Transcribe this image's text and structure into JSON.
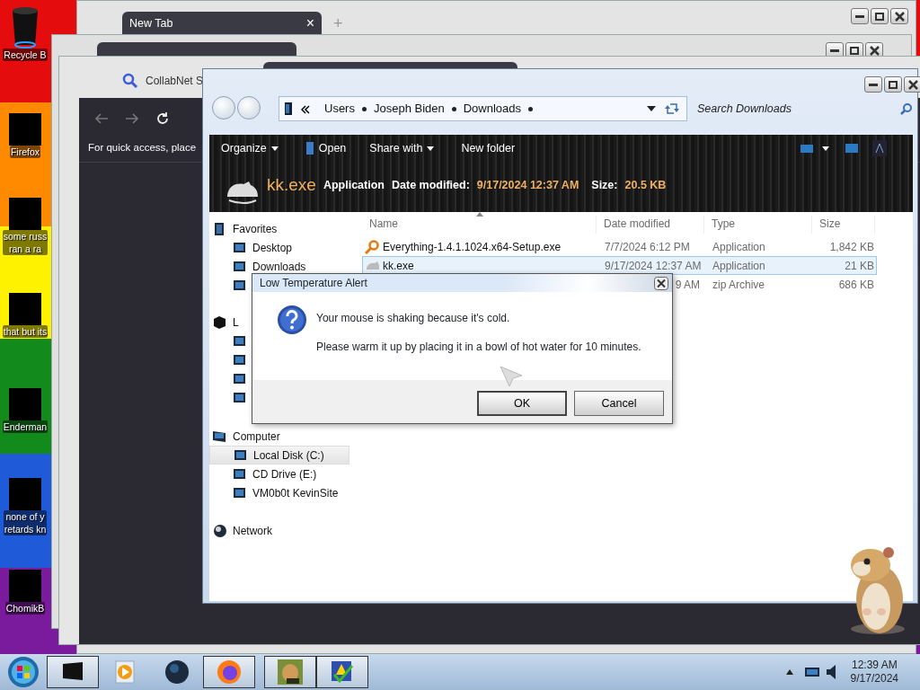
{
  "desktop_icons": [
    {
      "lines": [
        "Recycle B"
      ],
      "kind": "bin"
    },
    {
      "lines": [
        "Firefox"
      ],
      "kind": "app"
    },
    {
      "lines": [
        "some russ",
        "ran a ra"
      ],
      "kind": "app"
    },
    {
      "lines": [
        "that but its"
      ],
      "kind": "app"
    },
    {
      "lines": [
        "Enderman"
      ],
      "kind": "app"
    },
    {
      "lines": [
        "none of y",
        "retards kn"
      ],
      "kind": "app"
    },
    {
      "lines": [
        "ChomikB"
      ],
      "kind": "app"
    }
  ],
  "browser_back": {
    "tab": "New Tab",
    "close": "×",
    "new_tab": "+"
  },
  "browser_front": {
    "tab": "CollabNet S",
    "bookmarks_hint": "For quick access, place"
  },
  "explorer": {
    "breadcrumb": [
      "Users",
      "Joseph Biden",
      "Downloads"
    ],
    "search": {
      "placeholder": "Search Downloads"
    },
    "toolbar": [
      {
        "label": "Organize",
        "dropdown": true
      },
      {
        "label": "Open",
        "dropdown": false
      },
      {
        "label": "Share with",
        "dropdown": true
      },
      {
        "label": "New folder",
        "dropdown": false
      }
    ],
    "details": {
      "name": "kk.exe",
      "type": "Application",
      "date_label": "Date modified:",
      "date": "9/17/2024 12:37 AM",
      "size_label": "Size:",
      "size": "20.5 KB"
    },
    "columns": [
      "Name",
      "Date modified",
      "Type",
      "Size"
    ],
    "files": [
      {
        "name": "Everything-1.4.1.1024.x64-Setup.exe",
        "date": "7/7/2024 6:12 PM",
        "type": "Application",
        "size": "1,842 KB",
        "partial": false,
        "selected": false
      },
      {
        "name": "kk.exe",
        "date": "9/17/2024 12:37 AM",
        "type": "Application",
        "size": "21 KB",
        "partial": false,
        "selected": true
      },
      {
        "date": "9 AM",
        "partial": true,
        "type": "zip Archive",
        "size": "686 KB",
        "selected": false
      }
    ],
    "nav": [
      {
        "label": "Favorites",
        "selected": false,
        "children": [
          {
            "label": "Desktop",
            "selected": false
          },
          {
            "label": "Downloads",
            "selected": false
          },
          {
            "selected": false
          }
        ]
      },
      {
        "label": "L",
        "selected": false,
        "children": [
          {
            "selected": false
          },
          {
            "selected": false
          },
          {
            "selected": false
          },
          {
            "selected": false
          }
        ]
      },
      {
        "label": "Computer",
        "selected": false,
        "children": [
          {
            "label": "Local Disk (C:)",
            "selected": true
          },
          {
            "label": "CD Drive (E:)",
            "selected": false
          },
          {
            "label": "VM0b0t KevinSite",
            "selected": false
          }
        ]
      },
      {
        "label": "Network",
        "selected": false
      }
    ]
  },
  "dialog": {
    "title": "Low Temperature Alert",
    "lines": [
      "Your mouse is shaking because it's cold.",
      "Please warm it up by placing it in a bowl of hot water for 10 minutes."
    ],
    "buttons": [
      {
        "label": "OK",
        "default": true
      },
      {
        "label": "Cancel",
        "default": false
      }
    ]
  },
  "taskbar": {
    "apps": [
      {
        "kind": "monitor",
        "active": true
      },
      {
        "kind": "media",
        "active": false
      },
      {
        "kind": "globe",
        "active": false
      },
      {
        "kind": "firefox",
        "active": true
      },
      {
        "kind": "picture",
        "active": true
      },
      {
        "kind": "checklist",
        "active": true
      }
    ],
    "time": "12:39 AM",
    "date": "9/17/2024"
  }
}
